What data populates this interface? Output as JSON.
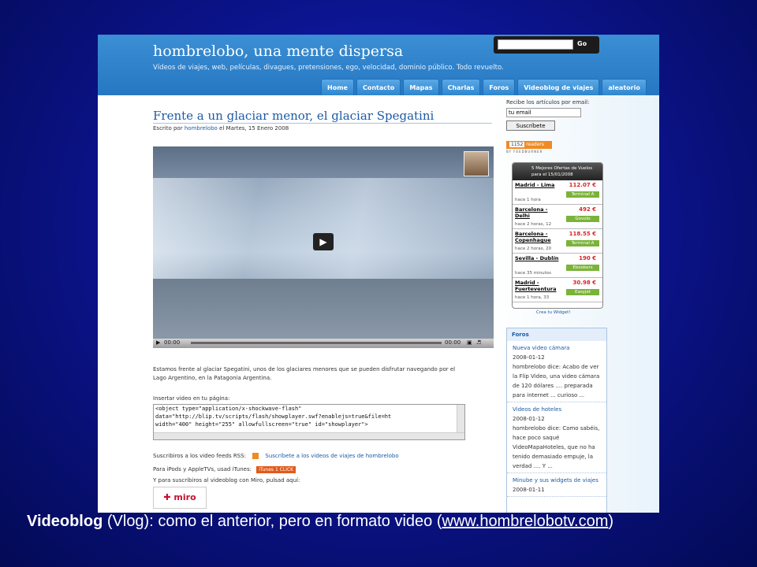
{
  "site": {
    "title": "hombrelobo, una mente dispersa",
    "tagline": "Vídeos de viajes, web, películas, divagues, pretensiones, ego, velocidad, dominio público. Todo revuelto.",
    "search_button": "Go"
  },
  "nav": [
    "Home",
    "Contacto",
    "Mapas",
    "Charlas",
    "Foros",
    "Videoblog de viajes",
    "aleatorio"
  ],
  "post": {
    "title": "Frente a un glaciar menor, el glaciar Spegatini",
    "meta_prefix": "Escrito por",
    "author": "hombrelobo",
    "date": "el Martes, 15 Enero 2008",
    "time_start": "00:00",
    "time_end": "00:00",
    "body": "Estamos frente al glaciar Spegatini, unos de los glaciares menores que se pueden disfrutar navegando por el Lago Argentino, en la Patagonia Argentina.",
    "embed_label": "Insertar video en tu página:",
    "embed_lines": [
      "<object type=\"application/x-shockwave-flash\"",
      "data=\"http://blip.tv/scripts/flash/showplayer.swf?enablejs=true&file=ht",
      "width=\"400\" height=\"255\" allowfullscreen=\"true\" id=\"showplayer\">"
    ],
    "rss_label": "Suscribiros a los video feeds RSS:",
    "rss_link": "Suscríbete a los videos de viajes de hombrelobo",
    "itunes_label": "Para iPods y AppleTVs, usad iTunes:",
    "itunes_badge": "iTunes 1 CLICK",
    "miro_label": "Y para suscribiros al videoblog con Miro, pulsad aquí:",
    "miro_button": "miro"
  },
  "sidebar": {
    "subscribe_label": "Recibe los artículos por email:",
    "email_value": "tu email",
    "subscribe_button": "Suscríbete",
    "feedburner_count": "1152",
    "feedburner_text": "readers",
    "feedburner_caption": "BY FEEDBURNER",
    "flights_title": "5 Mejores Ofertas de Vuelos para el 15/01/2008",
    "flights": [
      {
        "route": "Madrid - Lima",
        "ago": "hace 1 hora",
        "price": "112.07 €",
        "vendor": "Terminal A"
      },
      {
        "route": "Barcelona - Delhi",
        "ago": "hace 2 horas, 12",
        "price": "492 €",
        "vendor": "Govolo"
      },
      {
        "route": "Barcelona - Copenhague",
        "ago": "hace 2 horas, 20",
        "price": "118.55 €",
        "vendor": "Terminal A"
      },
      {
        "route": "Sevilla - Dublín",
        "ago": "hace 35 minutos",
        "price": "190 €",
        "vendor": "Ebookers"
      },
      {
        "route": "Madrid - Fuerteventura",
        "ago": "hace 1 hora, 33",
        "price": "30.98 €",
        "vendor": "Easyjet"
      }
    ],
    "widget_link": "Crea tu Widget!",
    "foros_title": "Foros",
    "foros": [
      {
        "title": "Nueva video cámara",
        "date": "2008-01-12",
        "text": "hombrelobo dice: Acabo de ver la Flip Video, una video cámara de 120 dólares .... preparada para internet ... curioso ..."
      },
      {
        "title": "Videos de hoteles",
        "date": "2008-01-12",
        "text": "hombrelobo dice: Como sabéis, hace poco saqué VideoMapaHoteles, que no ha tenido demasiado empuje, la verdad .... Y ..."
      },
      {
        "title": "Minube y sus widgets de viajes",
        "date": "2008-01-11",
        "text": ""
      }
    ]
  },
  "caption": {
    "bold": "Videoblog",
    "text": " (Vlog): como el anterior, pero en formato video (",
    "url": "www.hombrelobotv.com",
    "close": ")"
  }
}
